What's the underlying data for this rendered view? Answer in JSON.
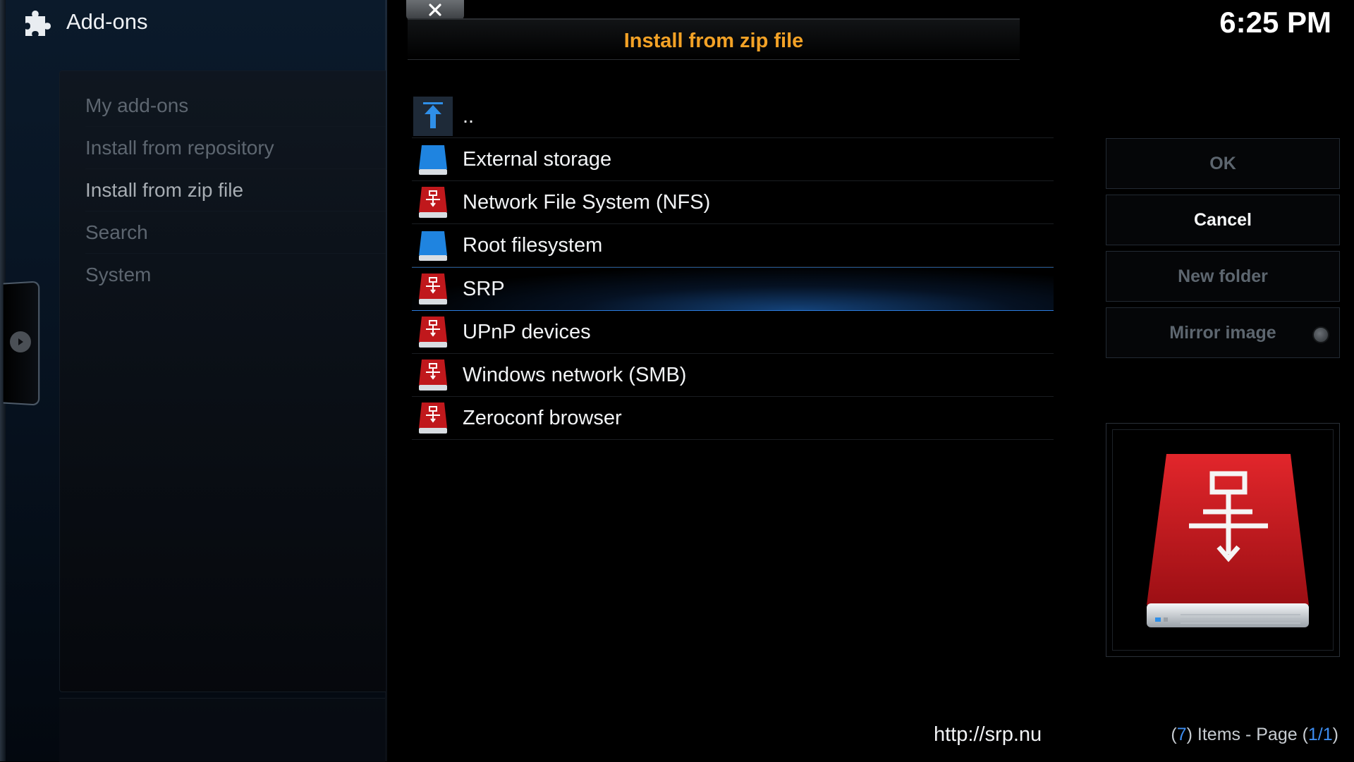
{
  "header": {
    "app_title": "Add-ons",
    "app_icon": "puzzle-icon",
    "clock": "6:25 PM"
  },
  "sidebar": {
    "items": [
      {
        "label": "My add-ons",
        "active": false
      },
      {
        "label": "Install from repository",
        "active": false
      },
      {
        "label": "Install from zip file",
        "active": true
      },
      {
        "label": "Search",
        "active": false
      },
      {
        "label": "System",
        "active": false
      }
    ]
  },
  "dialog": {
    "title": "Install from zip file",
    "close_icon": "close-icon",
    "title_color": "#f3a226",
    "items": [
      {
        "label": "..",
        "icon": "parent-folder-icon",
        "selected": false
      },
      {
        "label": "External storage",
        "icon": "blue-drive-icon",
        "selected": false
      },
      {
        "label": "Network File System (NFS)",
        "icon": "network-drive-icon",
        "selected": false
      },
      {
        "label": "Root filesystem",
        "icon": "blue-drive-icon",
        "selected": false
      },
      {
        "label": "SRP",
        "icon": "network-drive-icon",
        "selected": true
      },
      {
        "label": "UPnP devices",
        "icon": "network-drive-icon",
        "selected": false
      },
      {
        "label": "Windows network (SMB)",
        "icon": "network-drive-icon",
        "selected": false
      },
      {
        "label": "Zeroconf browser",
        "icon": "network-drive-icon",
        "selected": false
      }
    ]
  },
  "buttons": {
    "ok": "OK",
    "cancel": "Cancel",
    "new_folder": "New folder",
    "mirror_image": "Mirror image"
  },
  "preview": {
    "icon": "network-drive-large-icon"
  },
  "footer": {
    "url": "http://srp.nu",
    "items_open": "(",
    "items_count": "7",
    "items_text": ") Items - Page (",
    "page_current": "1/1",
    "items_close": ")"
  },
  "colors": {
    "accent_blue": "#3d8df0",
    "selection_glow": "#2478dc"
  }
}
